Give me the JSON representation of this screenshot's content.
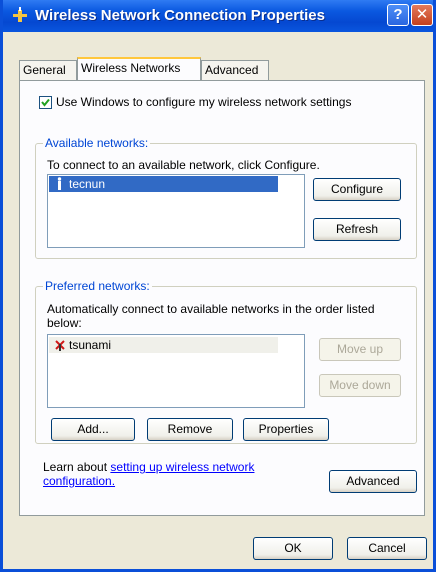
{
  "window": {
    "title": "Wireless Network Connection Properties",
    "help_glyph": "?",
    "close_glyph": "✕"
  },
  "tabs": [
    {
      "label": "General",
      "active": false
    },
    {
      "label": "Wireless Networks",
      "active": true
    },
    {
      "label": "Advanced",
      "active": false
    }
  ],
  "use_windows_checkbox": {
    "label": "Use Windows to configure my wireless network settings",
    "checked": true
  },
  "available": {
    "title": "Available networks:",
    "instruction": "To connect to an available network, click Configure.",
    "networks": [
      {
        "name": "tecnun",
        "icon": "wireless-antenna-icon",
        "selected": true
      }
    ],
    "configure_label": "Configure",
    "refresh_label": "Refresh"
  },
  "preferred": {
    "title": "Preferred networks:",
    "instruction_line1": "Automatically connect to available networks in the order listed",
    "instruction_line2": "below:",
    "networks": [
      {
        "name": "tsunami",
        "icon": "unavailable-network-icon"
      }
    ],
    "move_up_label": "Move up",
    "move_down_label": "Move down",
    "add_label": "Add...",
    "remove_label": "Remove",
    "properties_label": "Properties"
  },
  "learn": {
    "prefix": "Learn about ",
    "link_line1": "setting up wireless network",
    "link_line2": "configuration."
  },
  "advanced_label": "Advanced",
  "ok_label": "OK",
  "cancel_label": "Cancel",
  "colors": {
    "accent": "#0046d5",
    "selection": "#316ac5",
    "titlebar": "#0a58e0"
  }
}
